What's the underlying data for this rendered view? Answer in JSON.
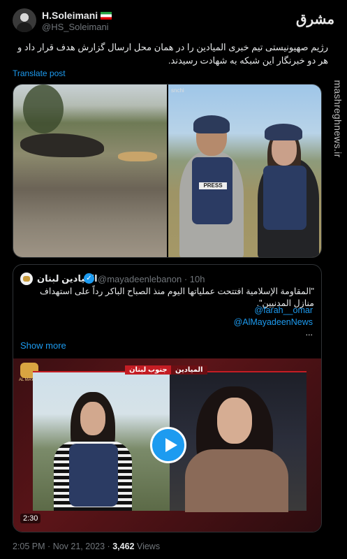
{
  "author": {
    "name": "H.Soleimani",
    "handle": "@HS_Soleimani"
  },
  "brand_logo": "مشرق",
  "watermark": "mashreghnews.ir",
  "tweet_text": "رژیم صهیونیستی تیم خبری المیادین را در همان محل ارسال گزارش هدف قرار داد و هر دو خبرنگار این شبکه به شهادت رسیدند.",
  "translate_label": "Translate post",
  "media": {
    "photo_badge": "snchi",
    "vest_label": "PRESS"
  },
  "quote": {
    "name": "الميادين لبنان",
    "handle": "@mayadeenlebanon",
    "separator": "·",
    "time": "10h",
    "text": "\"المقاومة الإسلامية افتتحت عملياتها اليوم منذ الصباح الباكر رداً على استهداف منازل المدنيين\".",
    "mention1": "@farah__omar",
    "mention2": "@AlMayadeenNews",
    "ellipsis": "...",
    "show_more": "Show more",
    "video": {
      "left_label": "جنوب لبنان",
      "right_label": "الميادين",
      "logo_text": "AL MAYADEEN",
      "duration": "2:30"
    }
  },
  "footer": {
    "time": "2:05 PM",
    "dot1": "·",
    "date": "Nov 21, 2023",
    "dot2": "·",
    "views_count": "3,462",
    "views_label": "Views"
  },
  "colors": {
    "background": "#000000",
    "link": "#1d9bf0",
    "muted": "#71767b",
    "border": "#2f3336"
  },
  "icons": [
    "verified-badge-icon",
    "play-icon",
    "iran-flag-icon"
  ]
}
